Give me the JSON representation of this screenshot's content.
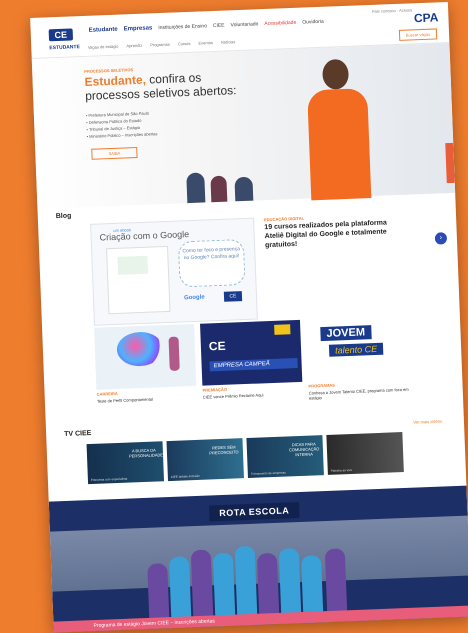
{
  "header": {
    "logo": "CE",
    "nav": [
      "Estudante",
      "Empresas",
      "Instituições de Ensino",
      "CIEE",
      "Voluntariado",
      "Acessibilidade",
      "Ouvidoria"
    ],
    "brand": "CPA",
    "top_links": "Fale conosco · Acesso",
    "subnav_lead": "ESTUDANTE",
    "subnav": [
      "Vagas de estágio",
      "Aprendiz",
      "Programas",
      "Cursos",
      "Eventos",
      "Notícias"
    ],
    "vagas_button": "Buscar vagas"
  },
  "hero": {
    "kicker": "PROCESSOS SELETIVOS",
    "title_bold": "Estudante,",
    "title_rest": " confira os processos seletivos abertos:",
    "bullets": [
      "• Prefeitura Municipal de São Paulo",
      "• Defensoria Pública do Estado",
      "• Tribunal de Justiça – Estágio",
      "• Ministério Público – Inscrições abertas"
    ],
    "cta": "SAIBA"
  },
  "blog": {
    "title": "Blog",
    "feature_title": "Criação com o Google",
    "feature_sub": "um ebook",
    "cloud_text": "Como ter foco e presença no Google? Confira aqui!",
    "google_label": "Google",
    "badge": "CE",
    "article_kicker": "EDUCAÇÃO DIGITAL",
    "article_title": "19 cursos realizados pela plataforma Ateliê Digital do Google e totalmente gratuitos!"
  },
  "cards": [
    {
      "kicker": "CARREIRA",
      "text": "Teste de Perfil Comportamental"
    },
    {
      "kicker": "PREMIAÇÃO",
      "text": "CIEE vence Prêmio Reclame Aqui",
      "logo": "CE",
      "stripe": "EMPRESA CAMPEÃ"
    },
    {
      "kicker": "PROGRAMAS",
      "text": "Conheça o Jovem Talento CIEE, programa com foco em estágio",
      "j": "JOVEM",
      "t": "talento CE"
    }
  ],
  "tv": {
    "title": "TV CIEE",
    "more": "Ver mais vídeos",
    "videos": [
      {
        "label": "A BUSCA DA PERSONALIDADE",
        "caption": "Entrevista com especialista"
      },
      {
        "label": "REDES SEM PRECONCEITO",
        "caption": "CIEE debate inclusão"
      },
      {
        "label": "DICAS PARA COMUNICAÇÃO INTERNA",
        "caption": "Treinamento de empresas"
      },
      {
        "label": "",
        "caption": "Palestra ao vivo"
      }
    ]
  },
  "rota": {
    "banner": "ROTA ESCOLA",
    "footer": "Programa de estágio Jovem CIEE – inscrições abertas"
  },
  "colors": {
    "accent": "#ef7d2e",
    "brand": "#1a3a8c"
  }
}
